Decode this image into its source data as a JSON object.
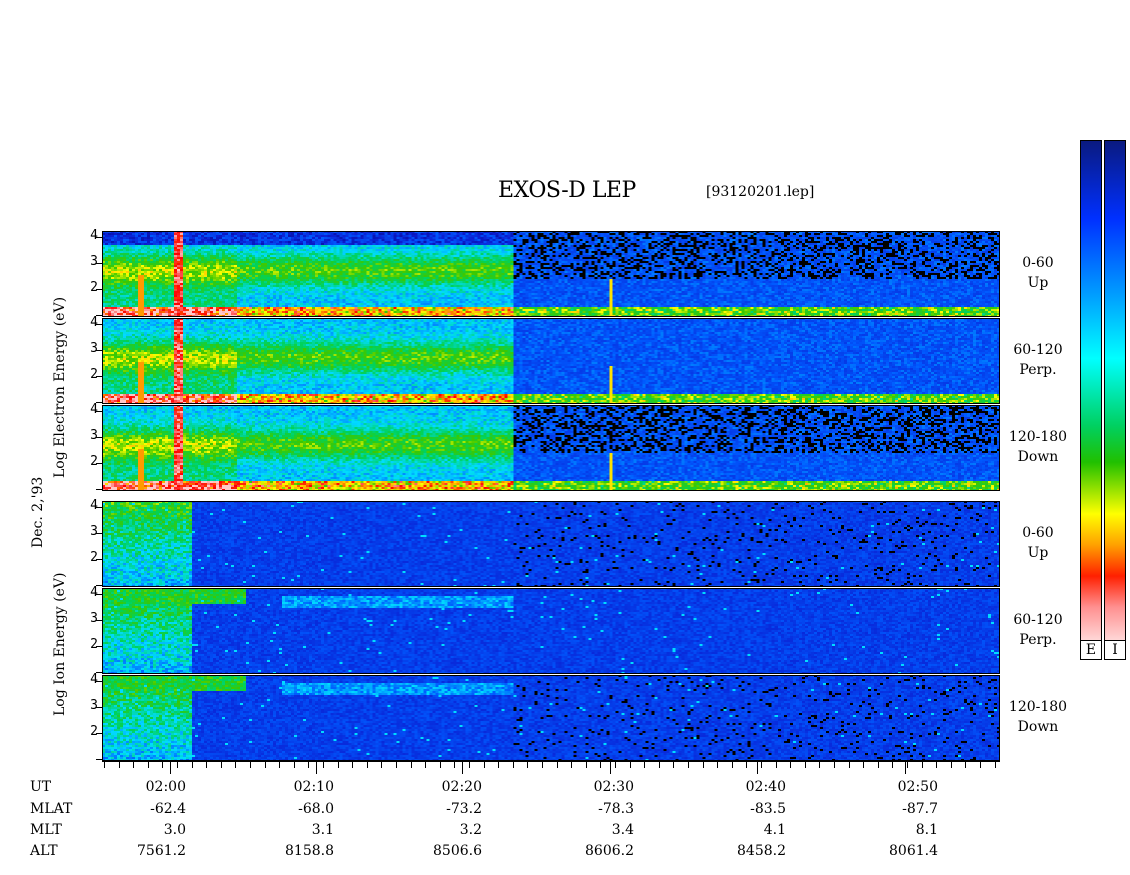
{
  "title": "EXOS-D LEP",
  "filename": "[93120201.lep]",
  "date_label": "Dec. 2,'93",
  "electron_ylabel": "Log   Electron   Energy   (eV)",
  "ion_ylabel": "Log   Ion   Energy   (eV)",
  "colorbar_labels": [
    "E",
    "I"
  ],
  "panels": [
    {
      "group": "electron",
      "pitch": "0-60",
      "dir": "Up"
    },
    {
      "group": "electron",
      "pitch": "60-120",
      "dir": "Perp."
    },
    {
      "group": "electron",
      "pitch": "120-180",
      "dir": "Down"
    },
    {
      "group": "ion",
      "pitch": "0-60",
      "dir": "Up"
    },
    {
      "group": "ion",
      "pitch": "60-120",
      "dir": "Perp."
    },
    {
      "group": "ion",
      "pitch": "120-180",
      "dir": "Down"
    }
  ],
  "yticks": [
    "4",
    "3",
    "2"
  ],
  "orbit_table": {
    "row_labels": [
      "UT",
      "MLAT",
      "MLT",
      "ALT"
    ],
    "columns": [
      {
        "UT": "02:00",
        "MLAT": "-62.4",
        "MLT": "3.0",
        "ALT": "7561.2"
      },
      {
        "UT": "02:10",
        "MLAT": "-68.0",
        "MLT": "3.1",
        "ALT": "8158.8"
      },
      {
        "UT": "02:20",
        "MLAT": "-73.2",
        "MLT": "3.2",
        "ALT": "8506.6"
      },
      {
        "UT": "02:30",
        "MLAT": "-78.3",
        "MLT": "3.4",
        "ALT": "8606.2"
      },
      {
        "UT": "02:40",
        "MLAT": "-83.5",
        "MLT": "4.1",
        "ALT": "8458.2"
      },
      {
        "UT": "02:50",
        "MLAT": "-87.7",
        "MLT": "8.1",
        "ALT": "8061.4"
      }
    ]
  },
  "chart_data": {
    "type": "heatmap",
    "title": "EXOS-D LEP",
    "x_axis": "UT",
    "x_ticks": [
      "02:00",
      "02:10",
      "02:20",
      "02:30",
      "02:40",
      "02:50"
    ],
    "y_axis": "Log Energy (eV)",
    "y_ticks": [
      4,
      3,
      2,
      1
    ],
    "colorscale": [
      "#ffffff",
      "#ff0000",
      "#ffff00",
      "#00c800",
      "#00ffff",
      "#0000ff",
      "#000080"
    ],
    "colorbar_labels": [
      "E",
      "I"
    ],
    "series": [
      {
        "name": "0-60 Up",
        "species": "electron"
      },
      {
        "name": "60-120 Perp.",
        "species": "electron"
      },
      {
        "name": "120-180 Down",
        "species": "electron"
      },
      {
        "name": "0-60 Up",
        "species": "ion"
      },
      {
        "name": "60-120 Perp.",
        "species": "ion"
      },
      {
        "name": "120-180 Down",
        "species": "ion"
      }
    ]
  }
}
